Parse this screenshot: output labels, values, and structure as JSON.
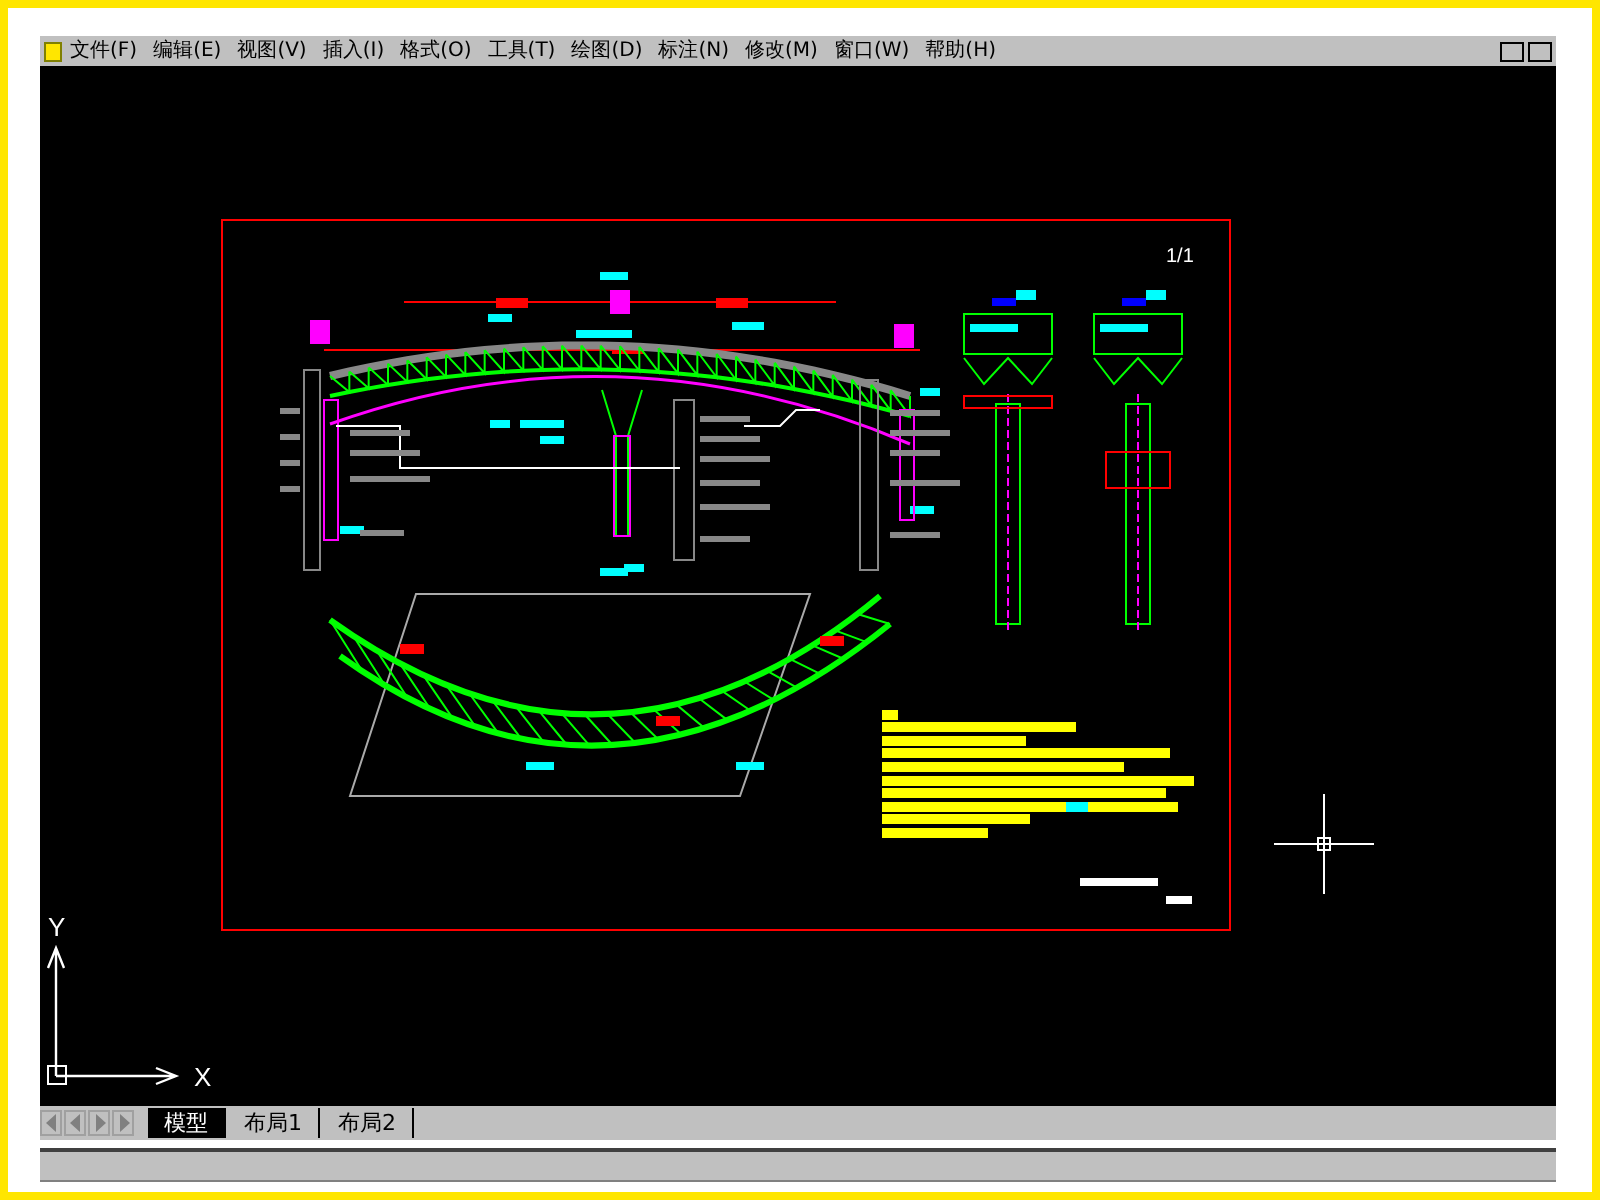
{
  "menu_bar": {
    "items": [
      "文件(F)",
      "编辑(E)",
      "视图(V)",
      "插入(I)",
      "格式(O)",
      "工具(T)",
      "绘图(D)",
      "标注(N)",
      "修改(M)",
      "窗口(W)",
      "帮助(H)"
    ]
  },
  "drawing": {
    "sheet_label": "1/1"
  },
  "ucs": {
    "x_label": "X",
    "y_label": "Y"
  },
  "layout_tabs": [
    {
      "label": "模型",
      "selected": true
    },
    {
      "label": "布局1",
      "selected": false
    },
    {
      "label": "布局2",
      "selected": false
    }
  ]
}
